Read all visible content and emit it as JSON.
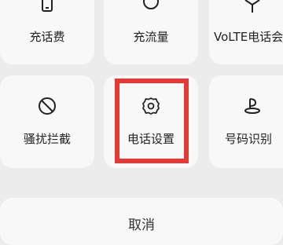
{
  "grid": {
    "row1": [
      {
        "label": "充话费",
        "icon": "phone-icon"
      },
      {
        "label": "充流量",
        "icon": "circle-icon"
      },
      {
        "label": "VoLTE电话会",
        "icon": "antenna-icon"
      }
    ],
    "row2": [
      {
        "label": "骚扰拦截",
        "icon": "block-icon"
      },
      {
        "label": "电话设置",
        "icon": "gear-icon"
      },
      {
        "label": "号码识别",
        "icon": "badge-icon"
      }
    ]
  },
  "highlight": {
    "color": "#e53935",
    "target": "电话设置"
  },
  "cancel": {
    "label": "取消"
  }
}
